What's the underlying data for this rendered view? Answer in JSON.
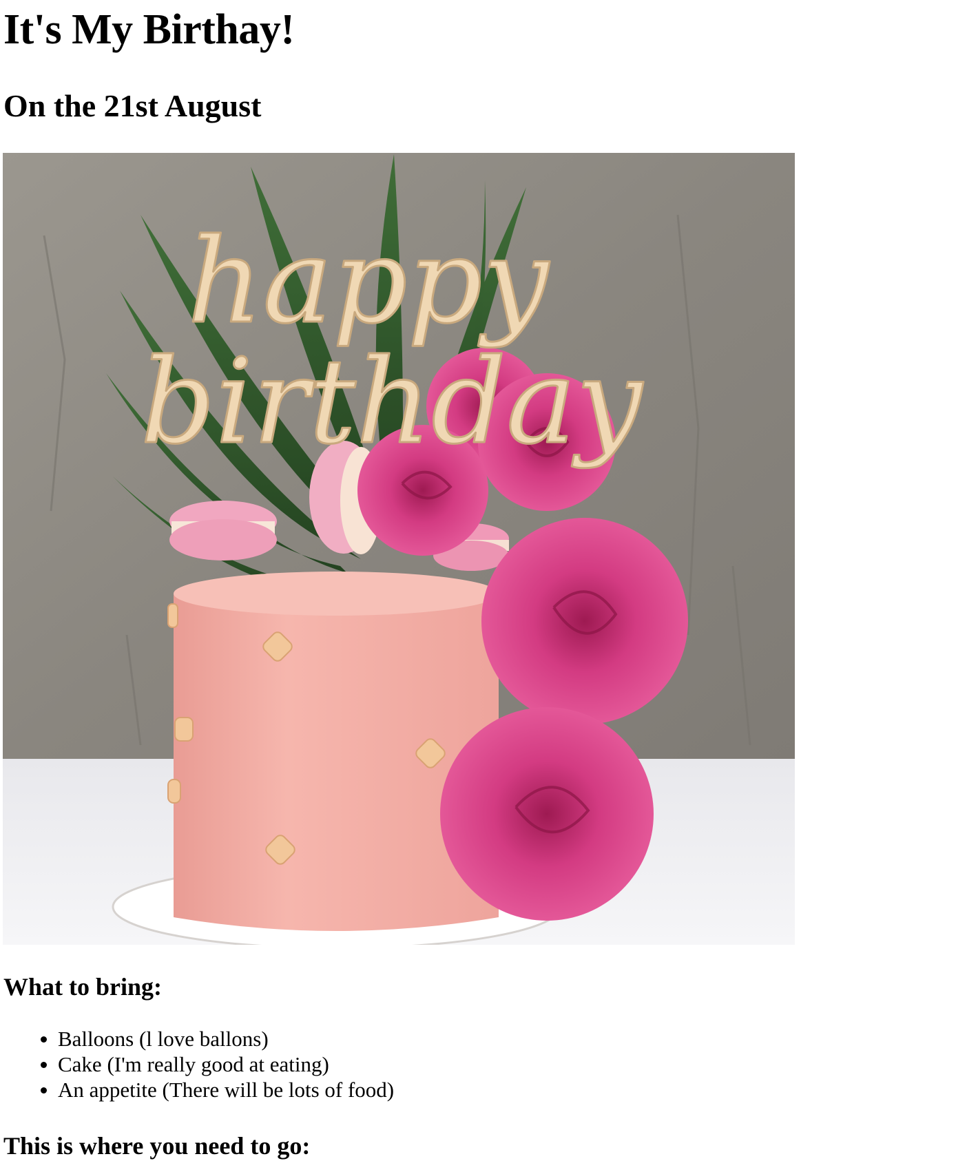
{
  "page": {
    "title": "It's My Birthay!",
    "date_heading": "On the 21st August",
    "image": {
      "alt": "Pink birthday cake with pink roses, macarons and a happy birthday topper",
      "topper_text": [
        "happy",
        "birthday"
      ]
    },
    "bring_heading": "What to bring:",
    "bring_items": [
      "Balloons (l love ballons)",
      "Cake (I'm really good at eating)",
      "An appetite (There will be lots of food)"
    ],
    "location_heading": "This is where you need to go:"
  },
  "colors": {
    "background": "#ffffff",
    "text": "#000000",
    "cake_pink": "#f3aea6",
    "rose_pink": "#d8367f",
    "wall_gray": "#8e8a85"
  }
}
